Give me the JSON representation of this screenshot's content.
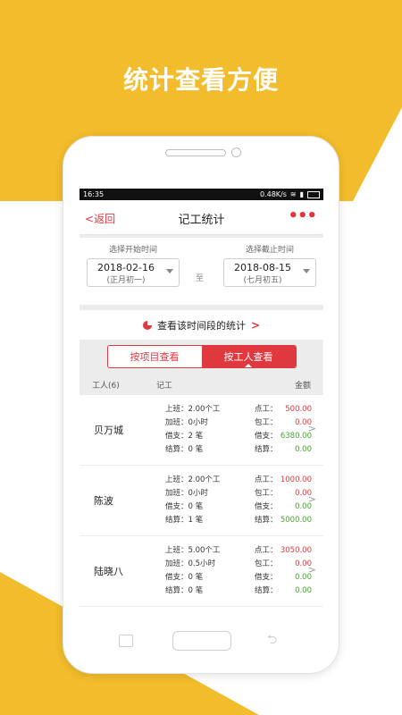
{
  "slogan": "统计查看方便",
  "colors": {
    "accent": "#e0383f",
    "brand_yellow": "#f2bc2c",
    "green": "#46a32e"
  },
  "statusbar": {
    "time": "16:35",
    "speed": "0.48K/s"
  },
  "header": {
    "back_label": "返回",
    "title": "记工统计",
    "more_icon": "more-icon"
  },
  "dates": {
    "start_label": "选择开始时间",
    "start_date": "2018-02-16",
    "start_lunar": "(正月初一)",
    "to_label": "至",
    "end_label": "选择截止时间",
    "end_date": "2018-08-15",
    "end_lunar": "(七月初五)"
  },
  "stat_link": {
    "label": "查看该时间段的统计"
  },
  "toggle": {
    "by_project": "按项目查看",
    "by_worker": "按工人查看"
  },
  "table": {
    "col_worker": "工人(6)",
    "col_record": "记工",
    "col_amount": "金额",
    "rows": [
      {
        "name": "贝万城",
        "mid": [
          "上班：2.00个工",
          "加班：0小时",
          "借支：2 笔",
          "结算：0 笔"
        ],
        "right_labels": [
          "点工：",
          "包工：",
          "借支：",
          "结算："
        ],
        "right_values": [
          "500.00",
          "0.00",
          "6380.00",
          "0.00"
        ]
      },
      {
        "name": "陈波",
        "mid": [
          "上班：2.00个工",
          "加班：0小时",
          "借支：0 笔",
          "结算：1 笔"
        ],
        "right_labels": [
          "点工：",
          "包工：",
          "借支：",
          "结算："
        ],
        "right_values": [
          "1000.00",
          "0.00",
          "0.00",
          "5000.00"
        ]
      },
      {
        "name": "陆晓八",
        "mid": [
          "上班：5.00个工",
          "加班：0.5小时",
          "借支：0 笔",
          "结算：0 笔"
        ],
        "right_labels": [
          "点工：",
          "包工：",
          "借支：",
          "结算："
        ],
        "right_values": [
          "3050.00",
          "0.00",
          "0.00",
          "0.00"
        ]
      }
    ]
  }
}
